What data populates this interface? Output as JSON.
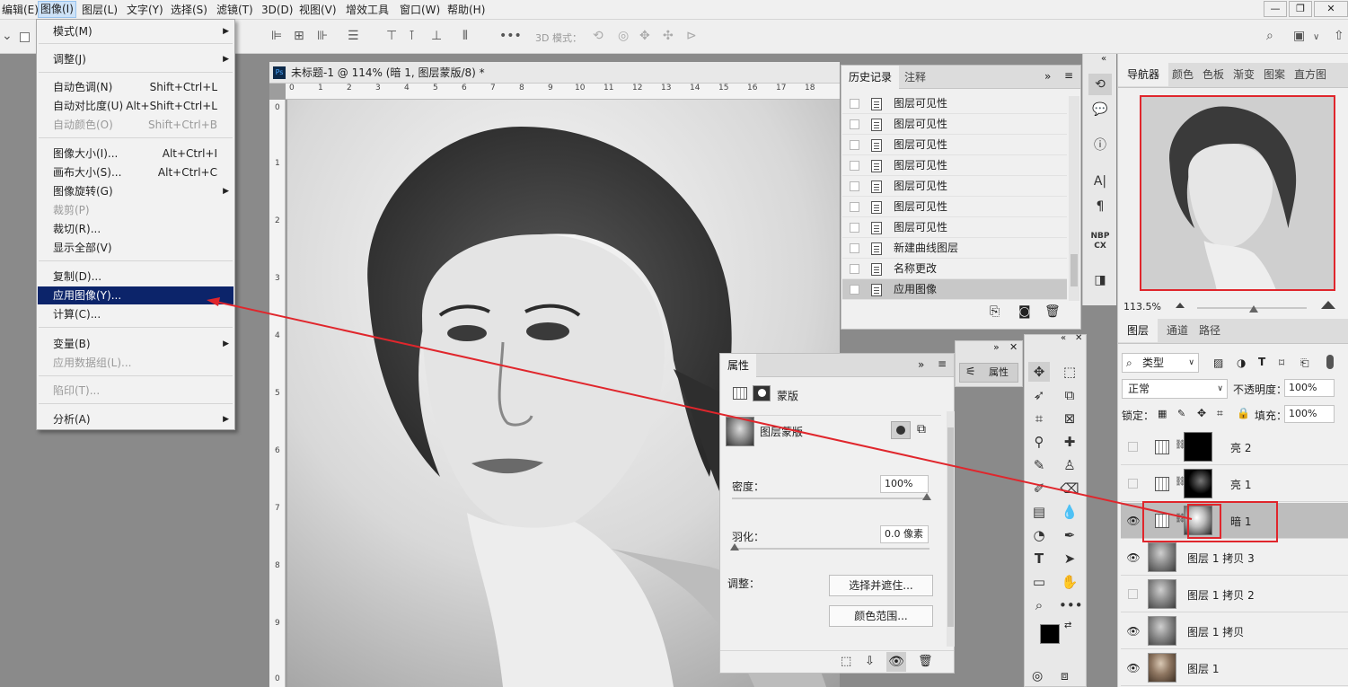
{
  "menubar": {
    "items": [
      "编辑(E)",
      "图像(I)",
      "图层(L)",
      "文字(Y)",
      "选择(S)",
      "滤镜(T)",
      "3D(D)",
      "视图(V)",
      "增效工具",
      "窗口(W)",
      "帮助(H)"
    ],
    "win_min": "—",
    "win_restore": "❐",
    "win_close": "✕"
  },
  "optbar": {
    "mode3d": "3D 模式："
  },
  "document": {
    "tab_title": "未标题-1 @ 114% (暗 1, 图层蒙版/8) *",
    "ps_icon": "Ps",
    "ruler_h": [
      "0",
      "1",
      "2",
      "3",
      "4",
      "5",
      "6",
      "7",
      "8",
      "9",
      "10",
      "11",
      "12",
      "13",
      "14",
      "15",
      "16",
      "17",
      "18"
    ],
    "ruler_v": [
      "0",
      "1",
      "2",
      "3",
      "4",
      "5",
      "6",
      "7",
      "8",
      "9",
      "0"
    ]
  },
  "image_menu": {
    "items": [
      {
        "label": "模式(M)",
        "shortcut": "",
        "submenu": true,
        "disabled": false
      },
      {
        "label": "调整(J)",
        "shortcut": "",
        "submenu": true,
        "disabled": false
      },
      {
        "label": "自动色调(N)",
        "shortcut": "Shift+Ctrl+L",
        "submenu": false,
        "disabled": false
      },
      {
        "label": "自动对比度(U)",
        "shortcut": "Alt+Shift+Ctrl+L",
        "submenu": false,
        "disabled": false
      },
      {
        "label": "自动颜色(O)",
        "shortcut": "Shift+Ctrl+B",
        "submenu": false,
        "disabled": true
      },
      {
        "label": "图像大小(I)...",
        "shortcut": "Alt+Ctrl+I",
        "submenu": false,
        "disabled": false
      },
      {
        "label": "画布大小(S)...",
        "shortcut": "Alt+Ctrl+C",
        "submenu": false,
        "disabled": false
      },
      {
        "label": "图像旋转(G)",
        "shortcut": "",
        "submenu": true,
        "disabled": false
      },
      {
        "label": "裁剪(P)",
        "shortcut": "",
        "submenu": false,
        "disabled": true
      },
      {
        "label": "裁切(R)...",
        "shortcut": "",
        "submenu": false,
        "disabled": false
      },
      {
        "label": "显示全部(V)",
        "shortcut": "",
        "submenu": false,
        "disabled": false
      },
      {
        "label": "复制(D)...",
        "shortcut": "",
        "submenu": false,
        "disabled": false
      },
      {
        "label": "应用图像(Y)...",
        "shortcut": "",
        "submenu": false,
        "disabled": false,
        "highlighted": true
      },
      {
        "label": "计算(C)...",
        "shortcut": "",
        "submenu": false,
        "disabled": false
      },
      {
        "label": "变量(B)",
        "shortcut": "",
        "submenu": true,
        "disabled": false
      },
      {
        "label": "应用数据组(L)...",
        "shortcut": "",
        "submenu": false,
        "disabled": true
      },
      {
        "label": "陷印(T)...",
        "shortcut": "",
        "submenu": false,
        "disabled": true
      },
      {
        "label": "分析(A)",
        "shortcut": "",
        "submenu": true,
        "disabled": false
      }
    ]
  },
  "history": {
    "tabs": [
      "历史记录",
      "注释"
    ],
    "rows": [
      "图层可见性",
      "图层可见性",
      "图层可见性",
      "图层可见性",
      "图层可见性",
      "图层可见性",
      "图层可见性",
      "新建曲线图层",
      "名称更改",
      "应用图像"
    ],
    "selected_index": 9
  },
  "properties": {
    "tab": "属性",
    "mask_type": "蒙版",
    "mask_label": "图层蒙版",
    "density_label": "密度：",
    "density_value": "100%",
    "feather_label": "羽化：",
    "feather_value": "0.0 像素",
    "adjust_label": "调整：",
    "btn_select_mask": "选择并遮住...",
    "btn_color_range": "颜色范围...",
    "collapsed_tab": "属性"
  },
  "navigator": {
    "tabs": [
      "导航器",
      "颜色",
      "色板",
      "渐变",
      "图案",
      "直方图"
    ],
    "zoom": "113.5%"
  },
  "layers": {
    "tabs": [
      "图层",
      "通道",
      "路径"
    ],
    "filter": "类型",
    "blend_mode": "正常",
    "opacity_label": "不透明度：",
    "opacity_value": "100%",
    "lock_label": "锁定：",
    "fill_label": "填充：",
    "fill_value": "100%",
    "rows": [
      {
        "name": "亮 2",
        "visible": false,
        "kind": "adjust"
      },
      {
        "name": "亮 1",
        "visible": false,
        "kind": "adjust"
      },
      {
        "name": "暗 1",
        "visible": true,
        "kind": "adjust",
        "selected": true
      },
      {
        "name": "图层 1 拷贝 3",
        "visible": true,
        "kind": "pixel"
      },
      {
        "name": "图层 1 拷贝 2",
        "visible": false,
        "kind": "pixel"
      },
      {
        "name": "图层 1 拷贝",
        "visible": true,
        "kind": "pixel"
      },
      {
        "name": "图层 1",
        "visible": true,
        "kind": "pixel"
      }
    ]
  },
  "right_strip": {
    "nbp": "NBP CX"
  },
  "colors": {
    "highlight": "#0c246a",
    "annotation": "#e0262c"
  }
}
